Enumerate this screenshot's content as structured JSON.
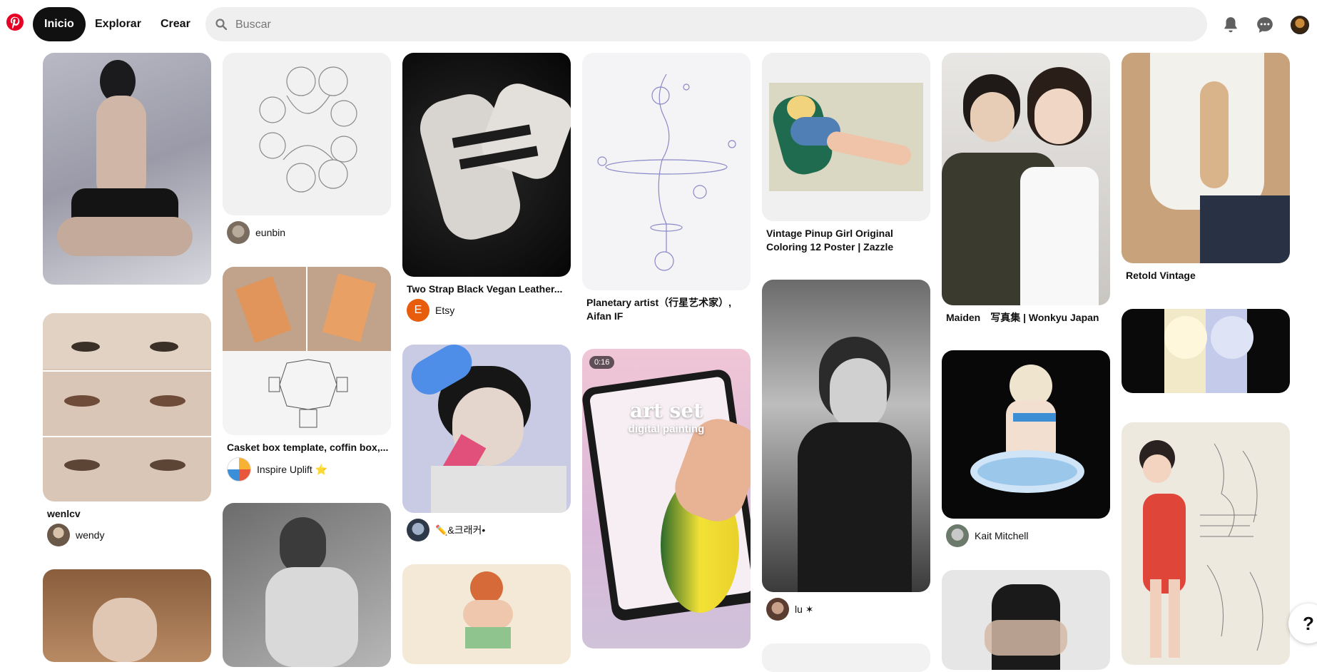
{
  "nav": {
    "home_label": "Inicio",
    "explore_label": "Explorar",
    "create_label": "Crear"
  },
  "search": {
    "placeholder": "Buscar"
  },
  "icons": {
    "brand": "pinterest-logo",
    "search": "search-icon",
    "notifications": "bell-icon",
    "messages": "chat-bubble-icon",
    "help": "question-mark"
  },
  "colors": {
    "brand_red": "#e60023",
    "nav_active_bg": "#111111",
    "search_bg": "#efefef"
  },
  "pins": {
    "c1p2": {
      "title": "wenlcv",
      "author": "wendy"
    },
    "c2p1": {
      "author": "eunbin"
    },
    "c2p2": {
      "title": "Casket box template, coffin box,...",
      "author": "Inspire Uplift ⭐"
    },
    "c3p1": {
      "title": "Two Strap Black Vegan Leather...",
      "author": "Etsy",
      "author_initial": "E"
    },
    "c3p2": {
      "author": "✏️&크래커•"
    },
    "c4p1": {
      "title": "Planetary artist（行星艺术家）, Aifan IF"
    },
    "c4p2": {
      "duration": "0:16",
      "overlay_title": "art set",
      "overlay_subtitle": "digital painting"
    },
    "c5p1": {
      "title": "Vintage Pinup Girl Original Coloring 12 Poster | Zazzle"
    },
    "c5p2": {
      "author": "lu ✶"
    },
    "c6p1": {
      "title": "Maiden　写真集 | Wonkyu Japan"
    },
    "c6p2": {
      "author": "Kait Mitchell"
    },
    "c7p1": {
      "title": "Retold Vintage"
    }
  },
  "help_glyph": "?"
}
